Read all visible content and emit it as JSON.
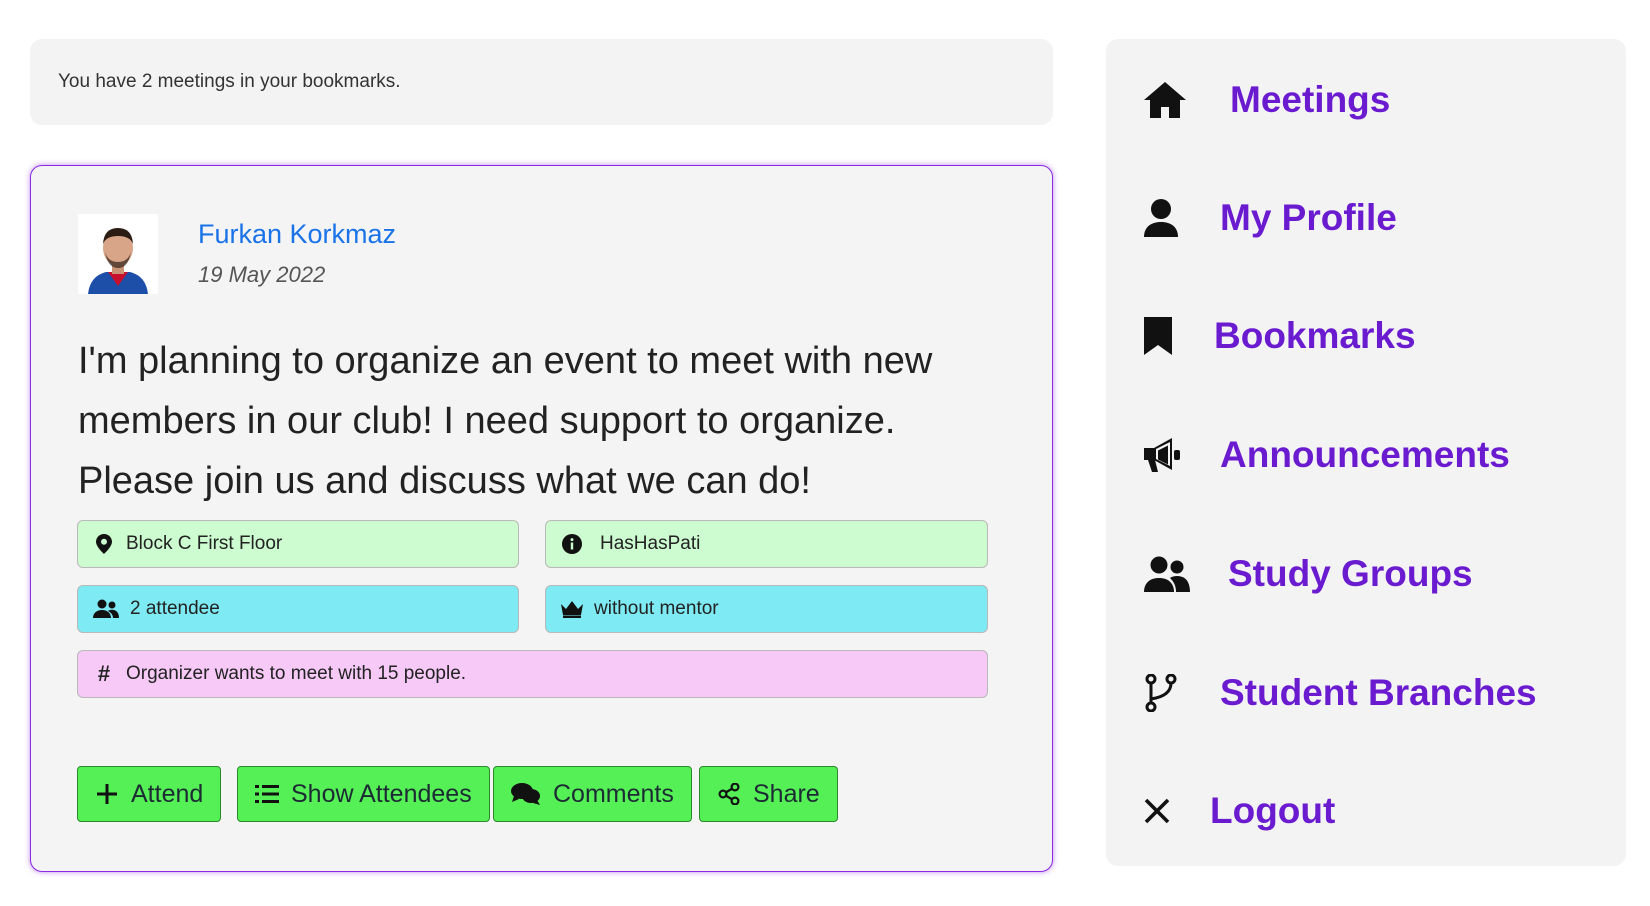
{
  "banner": {
    "text": "You have 2 meetings in your bookmarks."
  },
  "meeting": {
    "author": "Furkan Korkmaz",
    "date": "19 May 2022",
    "text": "I'm planning to organize an event to meet with new members in our club! I need support to organize. Please join us and discuss what we can do!",
    "location": "Block C First Floor",
    "club": "HasHasPati",
    "attendees": "2 attendee",
    "mentor": "without mentor",
    "capacity_note": "Organizer wants to meet with 15 people."
  },
  "actions": {
    "attend": "Attend",
    "show_attendees": "Show Attendees",
    "comments": "Comments",
    "share": "Share"
  },
  "sidebar": {
    "items": [
      {
        "label": "Meetings",
        "icon": "home-icon"
      },
      {
        "label": "My Profile",
        "icon": "user-icon"
      },
      {
        "label": "Bookmarks",
        "icon": "bookmark-icon"
      },
      {
        "label": "Announcements",
        "icon": "megaphone-icon"
      },
      {
        "label": "Study Groups",
        "icon": "users-icon"
      },
      {
        "label": "Student Branches",
        "icon": "branch-icon"
      },
      {
        "label": "Logout",
        "icon": "close-icon"
      }
    ]
  },
  "colors": {
    "accent": "#6a1bd0",
    "link": "#1a73e8",
    "card_border": "#8a2be2",
    "button": "#55ef56",
    "tag_green": "#ccfccf",
    "tag_cyan": "#7eeaf3",
    "tag_pink": "#f6c9f7"
  }
}
